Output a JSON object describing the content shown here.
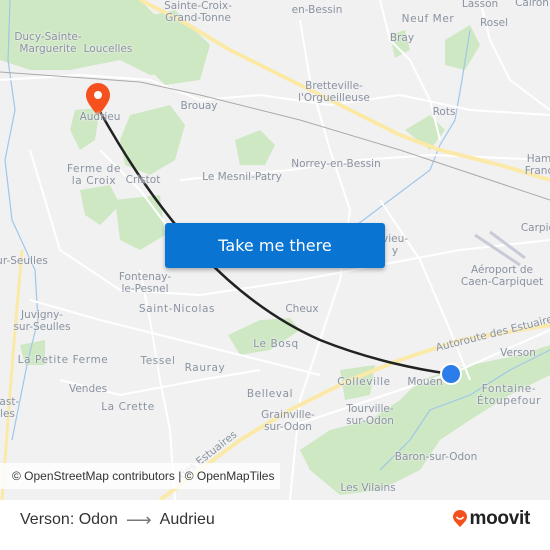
{
  "map": {
    "origin": {
      "name": "Verson: Odon",
      "near": "Mouen",
      "marker_color": "#2b7de9"
    },
    "destination": {
      "name": "Audrieu",
      "marker_color": "#f4511e"
    },
    "route_line_color": "#222222",
    "labels": [
      {
        "id": "sainte-croix",
        "text": "Sainte-Croix-\nGrand-Tonne"
      },
      {
        "id": "ducy",
        "text": "Ducy-Sainte-\nMarguerite"
      },
      {
        "id": "loucelles",
        "text": "Loucelles"
      },
      {
        "id": "en-bessin",
        "text": "en-Bessin"
      },
      {
        "id": "lasson",
        "text": "Lasson"
      },
      {
        "id": "cairon",
        "text": "Cairon"
      },
      {
        "id": "neuf-mer",
        "text": "Neuf Mer"
      },
      {
        "id": "rosel",
        "text": "Rosel"
      },
      {
        "id": "bray",
        "text": "Bray"
      },
      {
        "id": "bretteville",
        "text": "Bretteville-\nl'Orgueilleuse"
      },
      {
        "id": "brouay",
        "text": "Brouay"
      },
      {
        "id": "audrieu",
        "text": "Audrieu"
      },
      {
        "id": "rots",
        "text": "Rots"
      },
      {
        "id": "norrey",
        "text": "Norrey-en-Bessin"
      },
      {
        "id": "ham-franc",
        "text": "Ham\nFranc"
      },
      {
        "id": "ferme-croix",
        "text": "Ferme de\nla Croix"
      },
      {
        "id": "cristot",
        "text": "Cristot"
      },
      {
        "id": "mesnil-patry",
        "text": "Le Mesnil-Patry"
      },
      {
        "id": "carpiquet",
        "text": "Carpiq"
      },
      {
        "id": "vieux",
        "text": "vieu-\ny"
      },
      {
        "id": "sur-seulles",
        "text": "ur-Seulles"
      },
      {
        "id": "fontenay",
        "text": "Fontenay-\nle-Pesnel"
      },
      {
        "id": "aeroport",
        "text": "Aéroport de\nCaen-Carpiquet"
      },
      {
        "id": "saint-nicolas",
        "text": "Saint-Nicolas"
      },
      {
        "id": "cheux",
        "text": "Cheux"
      },
      {
        "id": "juvigny",
        "text": "Juvigny-\nsur-Seulles"
      },
      {
        "id": "le-bosq",
        "text": "Le Bosq"
      },
      {
        "id": "autoroute-1",
        "text": "Autoroute des Estuaires"
      },
      {
        "id": "verson",
        "text": "Verson"
      },
      {
        "id": "petite-ferme",
        "text": "La Petite Ferme"
      },
      {
        "id": "tessel",
        "text": "Tessel"
      },
      {
        "id": "rauray",
        "text": "Rauray"
      },
      {
        "id": "colleville",
        "text": "Colleville"
      },
      {
        "id": "mouen",
        "text": "Mouen"
      },
      {
        "id": "fontaine",
        "text": "Fontaine-\nÉtoupefour"
      },
      {
        "id": "vendes",
        "text": "Vendes"
      },
      {
        "id": "belleval",
        "text": "Belleval"
      },
      {
        "id": "tourville",
        "text": "Tourville-\nsur-Odon"
      },
      {
        "id": "hast",
        "text": "hast-\nlles"
      },
      {
        "id": "la-crette",
        "text": "La Crette"
      },
      {
        "id": "grainville",
        "text": "Grainville-\nsur-Odon"
      },
      {
        "id": "autoroute-2",
        "text": "des Estuaires"
      },
      {
        "id": "baron",
        "text": "Baron-sur-Odon"
      },
      {
        "id": "vilains",
        "text": "Les Vilains"
      }
    ],
    "attribution": "© OpenStreetMap contributors | © OpenMapTiles"
  },
  "cta": {
    "label": "Take me there"
  },
  "footer": {
    "origin": "Verson: Odon",
    "arrow": "⟶",
    "destination": "Audrieu",
    "brand": "moovit",
    "brand_color": "#f4511e"
  }
}
